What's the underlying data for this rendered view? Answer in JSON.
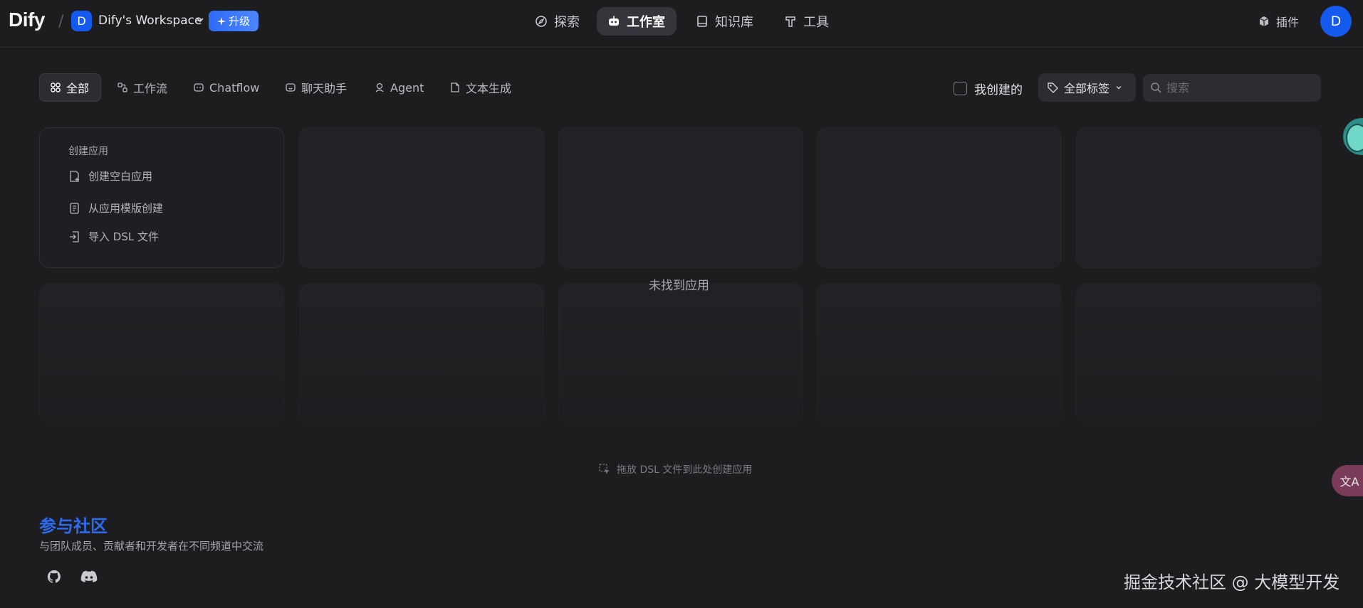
{
  "header": {
    "logo": "Dify",
    "separator": "/",
    "workspace": {
      "avatar": "D",
      "name": "Dify's Workspace"
    },
    "upgrade_label": "升级",
    "nav": [
      {
        "label": "探索",
        "icon": "explore-icon"
      },
      {
        "label": "工作室",
        "icon": "robot-icon",
        "active": true
      },
      {
        "label": "知识库",
        "icon": "book-icon"
      },
      {
        "label": "工具",
        "icon": "hammer-icon"
      }
    ],
    "plugins_label": "插件",
    "user_avatar": "D"
  },
  "filters": {
    "tabs": [
      {
        "label": "全部",
        "icon": "grid-icon",
        "active": true
      },
      {
        "label": "工作流",
        "icon": "workflow-icon"
      },
      {
        "label": "Chatflow",
        "icon": "chat-icon"
      },
      {
        "label": "聊天助手",
        "icon": "chat-bot-icon"
      },
      {
        "label": "Agent",
        "icon": "agent-icon"
      },
      {
        "label": "文本生成",
        "icon": "document-icon"
      }
    ],
    "mine_label": "我创建的",
    "tags_label": "全部标签",
    "search_placeholder": "搜索"
  },
  "create_card": {
    "title": "创建应用",
    "items": [
      {
        "label": "创建空白应用",
        "icon": "new-file-icon"
      },
      {
        "label": "从应用模版创建",
        "icon": "template-icon"
      },
      {
        "label": "导入 DSL 文件",
        "icon": "import-icon"
      }
    ]
  },
  "empty_message": "未找到应用",
  "drop_hint": "拖放 DSL 文件到此处创建应用",
  "community": {
    "title": "参与社区",
    "description": "与团队成员、贡献者和开发者在不同频道中交流",
    "links": [
      {
        "icon": "github-icon"
      },
      {
        "icon": "discord-icon"
      }
    ]
  },
  "watermark": "掘金技术社区 @ 大模型开发",
  "floating": {
    "translate_label": "文A"
  },
  "colors": {
    "background": "#1d1d20",
    "accent": "#155aef",
    "community_title": "#2d6bf0"
  }
}
